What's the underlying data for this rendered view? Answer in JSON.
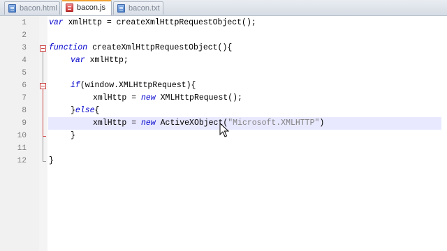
{
  "tabs": [
    {
      "label": "bacon.html",
      "icon": "html-file-icon",
      "active": false
    },
    {
      "label": "bacon.js",
      "icon": "js-file-icon",
      "active": true
    },
    {
      "label": "bacon.txt",
      "icon": "text-file-icon",
      "active": false
    }
  ],
  "editor": {
    "line_numbers": [
      "1",
      "2",
      "3",
      "4",
      "5",
      "6",
      "7",
      "8",
      "9",
      "10",
      "11",
      "12"
    ],
    "current_line": 9,
    "code": {
      "l1_kw": "var",
      "l1_rest": " xmlHttp = createXmlHttpRequestObject();",
      "l3_kw": "function",
      "l3_rest": " createXmlHttpRequestObject(){",
      "l4_kw": "var",
      "l4_rest": " xmlHttp;",
      "l6_kw": "if",
      "l6_rest": "(window.XMLHttpRequest){",
      "l7_pre": "xmlHttp = ",
      "l7_kw": "new",
      "l7_rest": " XMLHttpRequest();",
      "l8_pre": "}",
      "l8_kw": "else",
      "l8_rest": "{",
      "l9_pre": "xmlHttp = ",
      "l9_kw": "new",
      "l9_mid": " ActiveXObject(",
      "l9_str": "\"Microsoft.XMLHTTP\"",
      "l9_post": ")",
      "l10": "}",
      "l12": "}"
    }
  },
  "colors": {
    "keyword": "#0000cc",
    "string": "#808080",
    "current_line": "#e8e8ff",
    "active_tab_accent": "#f0a030",
    "fold_marker": "#cc4444"
  }
}
